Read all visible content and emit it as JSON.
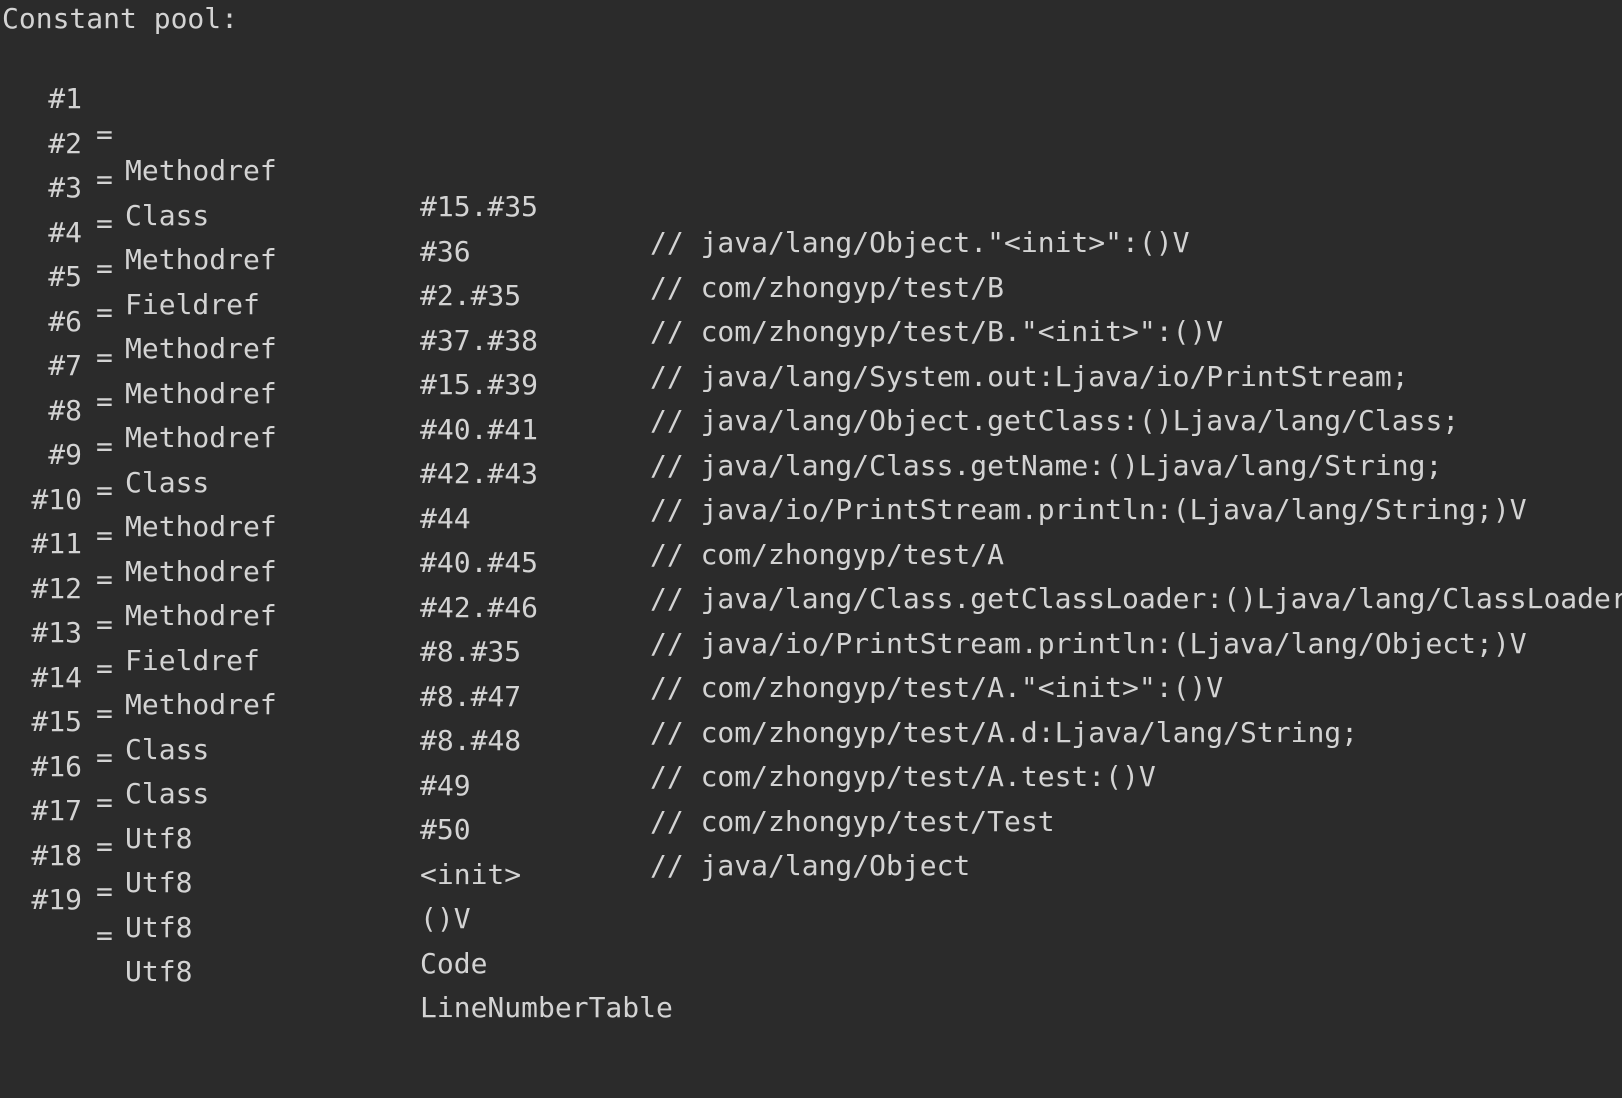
{
  "terminal": {
    "header": "Constant pool:",
    "colors": {
      "background": "#2b2b2b",
      "text": "#d3d3d3"
    },
    "entries": [
      {
        "index": "#1",
        "eq": "=",
        "kind": "Methodref",
        "ref": "#15.#35",
        "comment": "// java/lang/Object.\"<init>\":()V"
      },
      {
        "index": "#2",
        "eq": "=",
        "kind": "Class",
        "ref": "#36",
        "comment": "// com/zhongyp/test/B"
      },
      {
        "index": "#3",
        "eq": "=",
        "kind": "Methodref",
        "ref": "#2.#35",
        "comment": "// com/zhongyp/test/B.\"<init>\":()V"
      },
      {
        "index": "#4",
        "eq": "=",
        "kind": "Fieldref",
        "ref": "#37.#38",
        "comment": "// java/lang/System.out:Ljava/io/PrintStream;"
      },
      {
        "index": "#5",
        "eq": "=",
        "kind": "Methodref",
        "ref": "#15.#39",
        "comment": "// java/lang/Object.getClass:()Ljava/lang/Class;"
      },
      {
        "index": "#6",
        "eq": "=",
        "kind": "Methodref",
        "ref": "#40.#41",
        "comment": "// java/lang/Class.getName:()Ljava/lang/String;"
      },
      {
        "index": "#7",
        "eq": "=",
        "kind": "Methodref",
        "ref": "#42.#43",
        "comment": "// java/io/PrintStream.println:(Ljava/lang/String;)V"
      },
      {
        "index": "#8",
        "eq": "=",
        "kind": "Class",
        "ref": "#44",
        "comment": "// com/zhongyp/test/A"
      },
      {
        "index": "#9",
        "eq": "=",
        "kind": "Methodref",
        "ref": "#40.#45",
        "comment": "// java/lang/Class.getClassLoader:()Ljava/lang/ClassLoader;"
      },
      {
        "index": "#10",
        "eq": "=",
        "kind": "Methodref",
        "ref": "#42.#46",
        "comment": "// java/io/PrintStream.println:(Ljava/lang/Object;)V"
      },
      {
        "index": "#11",
        "eq": "=",
        "kind": "Methodref",
        "ref": "#8.#35",
        "comment": "// com/zhongyp/test/A.\"<init>\":()V"
      },
      {
        "index": "#12",
        "eq": "=",
        "kind": "Fieldref",
        "ref": "#8.#47",
        "comment": "// com/zhongyp/test/A.d:Ljava/lang/String;"
      },
      {
        "index": "#13",
        "eq": "=",
        "kind": "Methodref",
        "ref": "#8.#48",
        "comment": "// com/zhongyp/test/A.test:()V"
      },
      {
        "index": "#14",
        "eq": "=",
        "kind": "Class",
        "ref": "#49",
        "comment": "// com/zhongyp/test/Test"
      },
      {
        "index": "#15",
        "eq": "=",
        "kind": "Class",
        "ref": "#50",
        "comment": "// java/lang/Object"
      },
      {
        "index": "#16",
        "eq": "=",
        "kind": "Utf8",
        "ref": "<init>",
        "comment": ""
      },
      {
        "index": "#17",
        "eq": "=",
        "kind": "Utf8",
        "ref": "()V",
        "comment": ""
      },
      {
        "index": "#18",
        "eq": "=",
        "kind": "Utf8",
        "ref": "Code",
        "comment": ""
      },
      {
        "index": "#19",
        "eq": "=",
        "kind": "Utf8",
        "ref": "LineNumberTable",
        "comment": ""
      }
    ]
  }
}
